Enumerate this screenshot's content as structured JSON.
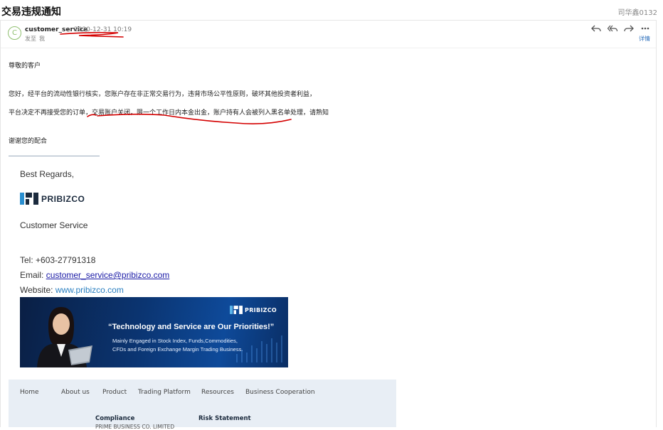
{
  "window": {
    "subject": "交易违规通知",
    "right_text": "司华鑫0132"
  },
  "header": {
    "avatar_letter": "C",
    "sender": "customer_service",
    "time": "2020-12-31 10:19",
    "to_label": "发至",
    "to_value": "我",
    "details_label": "详情"
  },
  "body": {
    "greeting": "尊敬的客户",
    "line1": "您好，经平台的流动性银行核实，您账户存在非正常交易行为，违背市场公平性原则，破坏其他投资者利益，",
    "line2": "平台决定不再接受您的订单，交易账户关闭，限一个工作日内本金出金，账户持有人会被列入黑名单处理，请熟知",
    "thanks": "谢谢您的配合"
  },
  "signature": {
    "regards": "Best Regards,",
    "brand": "PRIBIZCO",
    "role": "Customer Service",
    "tel": "Tel: +603-27791318",
    "email_label": "Email: ",
    "email": "customer_service@pribizco.com",
    "website_label": "Website: ",
    "website": "www.pribizco.com"
  },
  "banner": {
    "brand": "PRIBIZCO",
    "tagline": "“Technology and Service are Our Priorities!”",
    "sub1": "Mainly Engaged in Stock Index, Funds,Commodities,",
    "sub2": "CFDs and Foreign Exchange Margin Trading Business."
  },
  "footer": {
    "nav": [
      "Home",
      "About us",
      "Product",
      "Trading Platform",
      "Resources",
      "Business Cooperation"
    ],
    "compliance_title": "Compliance",
    "compliance_text": "PRIME BUSINESS CO. LIMITED",
    "risk_title": "Risk Statement"
  },
  "colors": {
    "link": "#1a1aa6",
    "website": "#2a7fc0",
    "banner": "#0b3572",
    "annotation": "#d40000"
  }
}
